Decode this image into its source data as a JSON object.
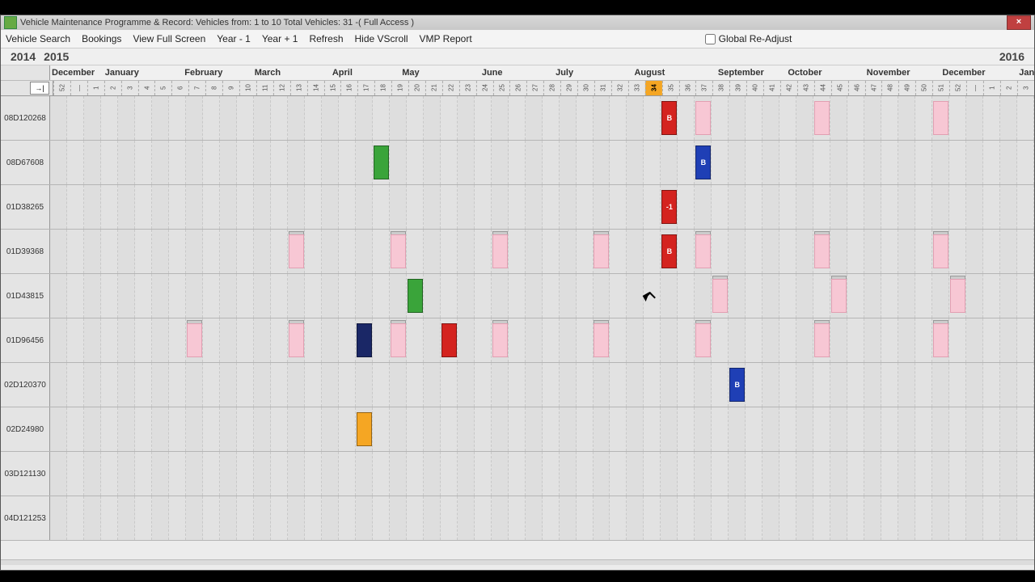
{
  "window": {
    "title": "Vehicle Maintenance Programme & Record: Vehicles from: 1 to 10 Total Vehicles: 31 -( Full Access )"
  },
  "menu": {
    "items": [
      "Vehicle Search",
      "Bookings",
      "View Full Screen",
      "Year - 1",
      "Year + 1",
      "Refresh",
      "Hide VScroll",
      "VMP Report"
    ],
    "global_readjust": "Global Re-Adjust"
  },
  "years": {
    "left": [
      "2014",
      "2015"
    ],
    "right": "2016"
  },
  "months": [
    {
      "label": "December",
      "pct": 0
    },
    {
      "label": "January",
      "pct": 5.4
    },
    {
      "label": "February",
      "pct": 13.5
    },
    {
      "label": "March",
      "pct": 20.6
    },
    {
      "label": "April",
      "pct": 28.5
    },
    {
      "label": "May",
      "pct": 35.6
    },
    {
      "label": "June",
      "pct": 43.7
    },
    {
      "label": "July",
      "pct": 51.2
    },
    {
      "label": "August",
      "pct": 59.2
    },
    {
      "label": "September",
      "pct": 67.7
    },
    {
      "label": "October",
      "pct": 74.8
    },
    {
      "label": "November",
      "pct": 82.8
    },
    {
      "label": "December",
      "pct": 90.5
    },
    {
      "label": "January",
      "pct": 98.3
    }
  ],
  "weeks": [
    "52",
    "—",
    "1",
    "2",
    "3",
    "4",
    "5",
    "6",
    "7",
    "8",
    "9",
    "10",
    "11",
    "12",
    "13",
    "14",
    "15",
    "16",
    "17",
    "18",
    "19",
    "20",
    "21",
    "22",
    "23",
    "24",
    "25",
    "26",
    "27",
    "28",
    "29",
    "30",
    "31",
    "32",
    "33",
    "34",
    "35",
    "36",
    "37",
    "38",
    "39",
    "40",
    "41",
    "42",
    "43",
    "44",
    "45",
    "46",
    "47",
    "48",
    "49",
    "50",
    "51",
    "52",
    "—",
    "1",
    "2",
    "3"
  ],
  "current_week_index": 35,
  "arrow_label": "→|",
  "rows": [
    {
      "id": "08D120268",
      "blocks": [
        {
          "col": 36,
          "cls": "red",
          "label": "B"
        },
        {
          "col": 38,
          "cls": "pink",
          "label": ""
        },
        {
          "col": 45,
          "cls": "pink",
          "label": ""
        },
        {
          "col": 52,
          "cls": "pink",
          "label": ""
        }
      ]
    },
    {
      "id": "08D67608",
      "blocks": [
        {
          "col": 19,
          "cls": "green",
          "label": ""
        },
        {
          "col": 38,
          "cls": "blue",
          "label": "B"
        }
      ]
    },
    {
      "id": "01D38265",
      "blocks": [
        {
          "col": 36,
          "cls": "red",
          "label": "-1"
        }
      ]
    },
    {
      "id": "01D39368",
      "blocks": [
        {
          "col": 14,
          "cls": "light"
        },
        {
          "col": 14,
          "cls": "pink",
          "label": ""
        },
        {
          "col": 20,
          "cls": "light"
        },
        {
          "col": 20,
          "cls": "pink",
          "label": ""
        },
        {
          "col": 26,
          "cls": "light"
        },
        {
          "col": 26,
          "cls": "pink",
          "label": ""
        },
        {
          "col": 32,
          "cls": "light"
        },
        {
          "col": 32,
          "cls": "pink",
          "label": ""
        },
        {
          "col": 36,
          "cls": "red",
          "label": "B"
        },
        {
          "col": 38,
          "cls": "light"
        },
        {
          "col": 38,
          "cls": "pink",
          "label": ""
        },
        {
          "col": 45,
          "cls": "light"
        },
        {
          "col": 45,
          "cls": "pink",
          "label": ""
        },
        {
          "col": 52,
          "cls": "light"
        },
        {
          "col": 52,
          "cls": "pink",
          "label": ""
        }
      ]
    },
    {
      "id": "01D43815",
      "blocks": [
        {
          "col": 21,
          "cls": "green",
          "label": ""
        },
        {
          "col": 39,
          "cls": "light"
        },
        {
          "col": 39,
          "cls": "pink",
          "label": ""
        },
        {
          "col": 46,
          "cls": "light"
        },
        {
          "col": 46,
          "cls": "pink",
          "label": ""
        },
        {
          "col": 53,
          "cls": "light"
        },
        {
          "col": 53,
          "cls": "pink",
          "label": ""
        }
      ]
    },
    {
      "id": "01D96456",
      "blocks": [
        {
          "col": 8,
          "cls": "light"
        },
        {
          "col": 8,
          "cls": "pink",
          "label": ""
        },
        {
          "col": 14,
          "cls": "light"
        },
        {
          "col": 14,
          "cls": "pink",
          "label": ""
        },
        {
          "col": 18,
          "cls": "navy",
          "label": ""
        },
        {
          "col": 20,
          "cls": "light"
        },
        {
          "col": 20,
          "cls": "pink",
          "label": ""
        },
        {
          "col": 23,
          "cls": "red",
          "label": ""
        },
        {
          "col": 26,
          "cls": "light"
        },
        {
          "col": 26,
          "cls": "pink",
          "label": ""
        },
        {
          "col": 32,
          "cls": "light"
        },
        {
          "col": 32,
          "cls": "pink",
          "label": ""
        },
        {
          "col": 38,
          "cls": "light"
        },
        {
          "col": 38,
          "cls": "pink",
          "label": ""
        },
        {
          "col": 45,
          "cls": "light"
        },
        {
          "col": 45,
          "cls": "pink",
          "label": ""
        },
        {
          "col": 52,
          "cls": "light"
        },
        {
          "col": 52,
          "cls": "pink",
          "label": ""
        }
      ]
    },
    {
      "id": "02D120370",
      "blocks": [
        {
          "col": 40,
          "cls": "blue",
          "label": "B"
        }
      ]
    },
    {
      "id": "02D24980",
      "blocks": [
        {
          "col": 18,
          "cls": "orange",
          "label": ""
        }
      ]
    },
    {
      "id": "03D121130",
      "blocks": []
    },
    {
      "id": "04D121253",
      "blocks": []
    }
  ],
  "cursor": {
    "row": 4,
    "col": 35
  }
}
